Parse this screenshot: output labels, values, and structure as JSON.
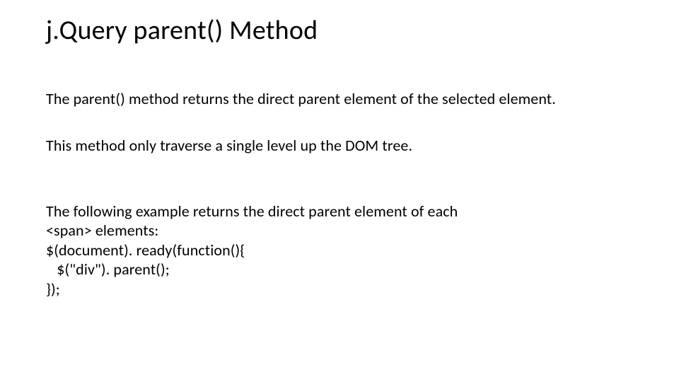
{
  "title": "j.Query parent() Method",
  "paragraph1": "The parent() method returns the direct parent element of the selected element.",
  "paragraph2": "This method only traverse a single level up the DOM tree.",
  "paragraph3_line1": "The following example returns the direct parent element of each",
  "paragraph3_line2": "<span> elements:",
  "code_line1": "$(document). ready(function(){",
  "code_line2": "   $(\"div\"). parent();",
  "code_line3": "});"
}
